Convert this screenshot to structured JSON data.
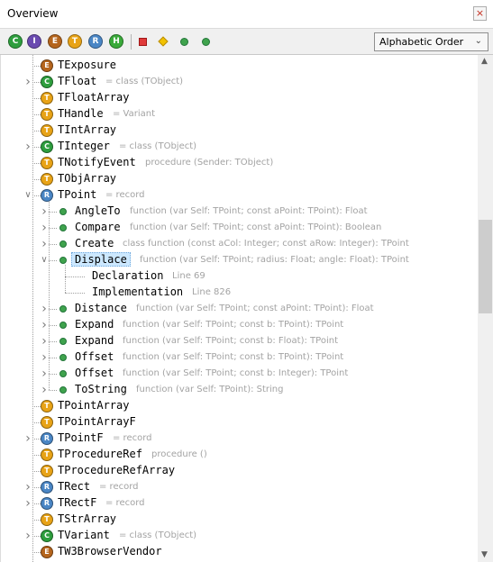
{
  "window": {
    "title": "Overview",
    "close_glyph": "×"
  },
  "toolbar": {
    "buttons": [
      {
        "letter": "C",
        "color": "#2e9e3e"
      },
      {
        "letter": "I",
        "color": "#6a4ab0"
      },
      {
        "letter": "E",
        "color": "#b5651d"
      },
      {
        "letter": "T",
        "color": "#e8a317"
      },
      {
        "letter": "R",
        "color": "#4a86c5"
      },
      {
        "letter": "H",
        "color": "#3aaa3a"
      }
    ],
    "filter_icons": [
      "red-square-icon",
      "yellow-diamond-icon",
      "green-dot-icon",
      "green-dot-icon"
    ],
    "sort_select": "Alphabetic Order"
  },
  "tree": {
    "items": [
      {
        "kind": "E",
        "name": "TExposure",
        "desc": "",
        "expander": ""
      },
      {
        "kind": "C",
        "name": "TFloat",
        "desc": "= class (TObject)",
        "expander": ">"
      },
      {
        "kind": "T",
        "name": "TFloatArray",
        "desc": "",
        "expander": ""
      },
      {
        "kind": "T",
        "name": "THandle",
        "desc": "= Variant",
        "expander": ""
      },
      {
        "kind": "T",
        "name": "TIntArray",
        "desc": "",
        "expander": ""
      },
      {
        "kind": "C",
        "name": "TInteger",
        "desc": "= class (TObject)",
        "expander": ">"
      },
      {
        "kind": "T",
        "name": "TNotifyEvent",
        "desc": "procedure (Sender: TObject)",
        "expander": ""
      },
      {
        "kind": "T",
        "name": "TObjArray",
        "desc": "",
        "expander": ""
      },
      {
        "kind": "R",
        "name": "TPoint",
        "desc": "= record",
        "expander": "v"
      },
      {
        "kind": "M",
        "name": "AngleTo",
        "desc": "function (var Self: TPoint; const aPoint: TPoint): Float",
        "expander": ">"
      },
      {
        "kind": "M",
        "name": "Compare",
        "desc": "function (var Self: TPoint; const aPoint: TPoint): Boolean",
        "expander": ">"
      },
      {
        "kind": "M",
        "name": "Create",
        "desc": "class function (const aCol: Integer; const aRow: Integer): TPoint",
        "expander": ">"
      },
      {
        "kind": "M",
        "name": "Displace",
        "desc": "function (var Self: TPoint; radius: Float; angle: Float): TPoint",
        "expander": "v",
        "selected": true
      },
      {
        "kind": "L",
        "name": "Declaration",
        "desc": "Line 69",
        "expander": ""
      },
      {
        "kind": "L",
        "name": "Implementation",
        "desc": "Line 826",
        "expander": ""
      },
      {
        "kind": "M",
        "name": "Distance",
        "desc": "function (var Self: TPoint; const aPoint: TPoint): Float",
        "expander": ">"
      },
      {
        "kind": "M",
        "name": "Expand",
        "desc": "function (var Self: TPoint; const b: TPoint): TPoint",
        "expander": ">"
      },
      {
        "kind": "M",
        "name": "Expand",
        "desc": "function (var Self: TPoint; const b: Float): TPoint",
        "expander": ">"
      },
      {
        "kind": "M",
        "name": "Offset",
        "desc": "function (var Self: TPoint; const b: TPoint): TPoint",
        "expander": ">"
      },
      {
        "kind": "M",
        "name": "Offset",
        "desc": "function (var Self: TPoint; const b: Integer): TPoint",
        "expander": ">"
      },
      {
        "kind": "M",
        "name": "ToString",
        "desc": "function (var Self: TPoint): String",
        "expander": ">"
      },
      {
        "kind": "T",
        "name": "TPointArray",
        "desc": "",
        "expander": ""
      },
      {
        "kind": "T",
        "name": "TPointArrayF",
        "desc": "",
        "expander": ""
      },
      {
        "kind": "R",
        "name": "TPointF",
        "desc": "= record",
        "expander": ">"
      },
      {
        "kind": "T",
        "name": "TProcedureRef",
        "desc": "procedure ()",
        "expander": ""
      },
      {
        "kind": "T",
        "name": "TProcedureRefArray",
        "desc": "",
        "expander": ""
      },
      {
        "kind": "R",
        "name": "TRect",
        "desc": "= record",
        "expander": ">"
      },
      {
        "kind": "R",
        "name": "TRectF",
        "desc": "= record",
        "expander": ">"
      },
      {
        "kind": "T",
        "name": "TStrArray",
        "desc": "",
        "expander": ""
      },
      {
        "kind": "C",
        "name": "TVariant",
        "desc": "= class (TObject)",
        "expander": ">"
      },
      {
        "kind": "E",
        "name": "TW3BrowserVendor",
        "desc": "",
        "expander": ""
      }
    ]
  },
  "kind_colors": {
    "C": "#2e9e3e",
    "T": "#e8a317",
    "E": "#b5651d",
    "R": "#4a86c5",
    "M": "#3fa34d"
  }
}
